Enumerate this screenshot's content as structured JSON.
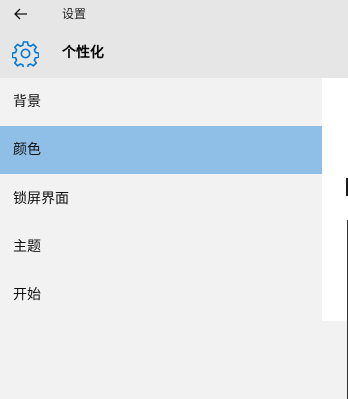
{
  "window": {
    "title": "设置"
  },
  "header": {
    "title": "个性化",
    "icon": "gear-icon"
  },
  "sidebar": {
    "items": [
      {
        "label": "背景",
        "selected": false
      },
      {
        "label": "颜色",
        "selected": true
      },
      {
        "label": "锁屏界面",
        "selected": false
      },
      {
        "label": "主题",
        "selected": false
      },
      {
        "label": "开始",
        "selected": false
      }
    ]
  },
  "colors": {
    "selected_item_bg": "#8fbfe6",
    "header_bg": "#e6e6e6",
    "sidebar_bg": "#f2f2f2",
    "accent": "#0078d7"
  }
}
